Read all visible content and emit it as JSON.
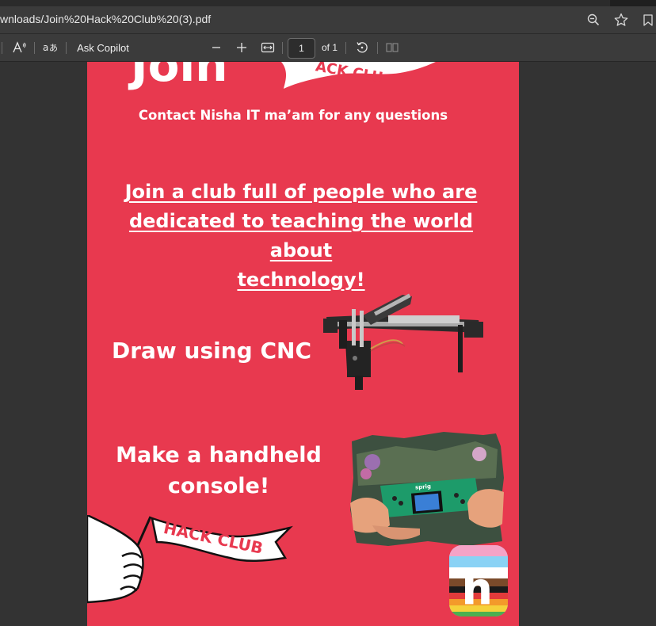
{
  "addressbar": {
    "url": "wnloads/Join%20Hack%20Club%20(3).pdf",
    "icons": [
      "zoom-icon",
      "favorite-star-icon",
      "bookmark-icon"
    ]
  },
  "toolbar": {
    "read_aloud_icon": "read-aloud-icon",
    "translate_icon": "translate-icon",
    "ask_copilot_label": "Ask Copilot",
    "zoom_out_icon": "minus-icon",
    "zoom_in_icon": "plus-icon",
    "fit_icon": "fit-width-icon",
    "page_number": "1",
    "page_total": "of 1",
    "rotate_icon": "rotate-icon",
    "layout_icon": "page-view-icon"
  },
  "document": {
    "page_bg": "#e8394f",
    "logo_text_partial": "Join",
    "flag_top_partial": "ACK CLU",
    "contact_text": "Contact Nisha IT ma’am for any questions",
    "headline_lines": [
      "Join a club full of people who are",
      "dedicated to teaching the world about",
      "technology!"
    ],
    "cnc_text": "Draw using CNC",
    "console_lines": [
      "Make a handheld",
      "console!"
    ],
    "console_screen_label": "sprig",
    "flag_text": "HACK CLUB",
    "app_logo_letter": "h"
  }
}
